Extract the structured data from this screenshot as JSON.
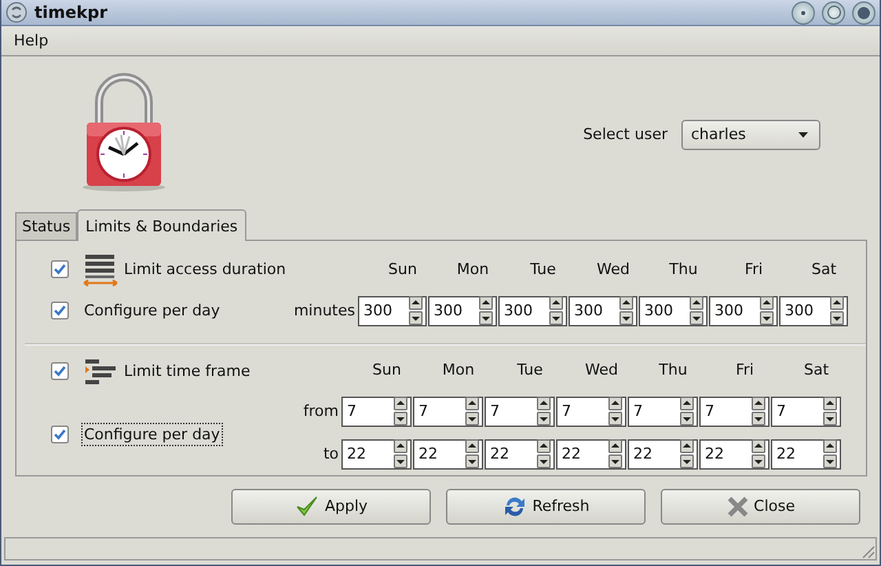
{
  "window": {
    "title": "timekpr"
  },
  "menu": [
    {
      "label": "Help"
    }
  ],
  "select_user": {
    "label": "Select user",
    "value": "charles"
  },
  "tabs": [
    {
      "label": "Status",
      "selected": false
    },
    {
      "label": "Limits & Boundaries",
      "selected": true
    }
  ],
  "duration": {
    "limit": {
      "label": "Limit access duration",
      "checked": true,
      "focused": false
    },
    "per_day": {
      "label": "Configure per day",
      "checked": true,
      "focused": false
    },
    "days": [
      "Sun",
      "Mon",
      "Tue",
      "Wed",
      "Thu",
      "Fri",
      "Sat"
    ],
    "rows": [
      {
        "label": "minutes",
        "values": [
          "300",
          "300",
          "300",
          "300",
          "300",
          "300",
          "300"
        ]
      }
    ]
  },
  "time_frame": {
    "limit": {
      "label": "Limit time frame",
      "checked": true,
      "focused": false
    },
    "per_day": {
      "label": "Configure per day",
      "checked": true,
      "focused": true
    },
    "days": [
      "Sun",
      "Mon",
      "Tue",
      "Wed",
      "Thu",
      "Fri",
      "Sat"
    ],
    "rows": [
      {
        "label": "from",
        "values": [
          "7",
          "7",
          "7",
          "7",
          "7",
          "7",
          "7"
        ]
      },
      {
        "label": "to",
        "values": [
          "22",
          "22",
          "22",
          "22",
          "22",
          "22",
          "22"
        ]
      }
    ]
  },
  "buttons": [
    {
      "label": "Apply",
      "kind": "apply"
    },
    {
      "label": "Refresh",
      "kind": "refresh"
    },
    {
      "label": "Close",
      "kind": "close"
    }
  ]
}
